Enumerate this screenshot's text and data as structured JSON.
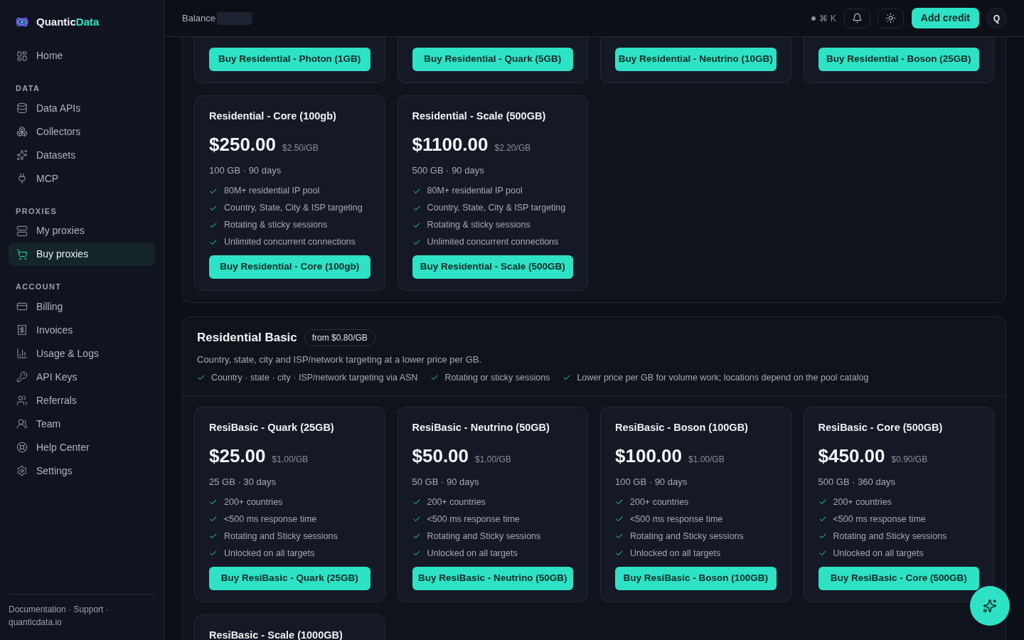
{
  "brand": {
    "name_start": "Quantic",
    "name_end": "Data"
  },
  "nav": [
    {
      "kind": "item",
      "label": "Home",
      "selected": false
    },
    {
      "kind": "heading",
      "label": "DATA"
    },
    {
      "kind": "item",
      "label": "Data APIs",
      "selected": false
    },
    {
      "kind": "item",
      "label": "Collectors",
      "selected": false
    },
    {
      "kind": "item",
      "label": "Datasets",
      "selected": false
    },
    {
      "kind": "item",
      "label": "MCP",
      "selected": false
    },
    {
      "kind": "heading",
      "label": "PROXIES"
    },
    {
      "kind": "item",
      "label": "My proxies",
      "selected": false
    },
    {
      "kind": "item",
      "label": "Buy proxies",
      "selected": true
    },
    {
      "kind": "heading",
      "label": "ACCOUNT"
    },
    {
      "kind": "item",
      "label": "Billing",
      "selected": false
    },
    {
      "kind": "item",
      "label": "Invoices",
      "selected": false
    },
    {
      "kind": "item",
      "label": "Usage & Logs",
      "selected": false
    },
    {
      "kind": "item",
      "label": "API Keys",
      "selected": false
    },
    {
      "kind": "item",
      "label": "Referrals",
      "selected": false
    },
    {
      "kind": "item",
      "label": "Team",
      "selected": false
    },
    {
      "kind": "item",
      "label": "Help Center",
      "selected": false
    },
    {
      "kind": "item",
      "label": "Settings",
      "selected": false
    }
  ],
  "sidebar_footer": "Documentation · Support · quanticdata.io",
  "header": {
    "balance_label": "Balance",
    "shortcut": "⌘ K",
    "add_credit": "Add credit",
    "avatar": "Q"
  },
  "sections": [
    {
      "cards": [
        {
          "kind": "bottom_only",
          "button": "Buy Residential - Photon (1GB)"
        },
        {
          "kind": "bottom_only",
          "button": "Buy Residential - Quark (5GB)"
        },
        {
          "kind": "bottom_only",
          "button": "Buy Residential - Neutrino (10GB)"
        },
        {
          "kind": "bottom_only",
          "button": "Buy Residential - Boson (25GB)"
        },
        {
          "kind": "full",
          "title": "Residential - Core (100gb)",
          "price": "$250.00",
          "per_gb": "$2.50/GB",
          "terms": "100 GB · 90 days",
          "features": [
            "80M+ residential IP pool",
            "Country, State, City & ISP targeting",
            "Rotating & sticky sessions",
            "Unlimited concurrent connections"
          ],
          "button": "Buy Residential - Core (100gb)"
        },
        {
          "kind": "full",
          "title": "Residential - Scale (500GB)",
          "price": "$1100.00",
          "per_gb": "$2.20/GB",
          "terms": "500 GB · 90 days",
          "features": [
            "80M+ residential IP pool",
            "Country, State, City & ISP targeting",
            "Rotating & sticky sessions",
            "Unlimited concurrent connections"
          ],
          "button": "Buy Residential - Scale (500GB)"
        }
      ]
    },
    {
      "title": "Residential Basic",
      "badge": "from $0.80/GB",
      "description": "Country, state, city and ISP/network targeting at a lower price per GB.",
      "features": [
        "Country · state · city · ISP/network targeting via ASN",
        "Rotating or sticky sessions",
        "Lower price per GB for volume work; locations depend on the pool catalog"
      ],
      "cards": [
        {
          "kind": "full",
          "title": "ResiBasic - Quark (25GB)",
          "price": "$25.00",
          "per_gb": "$1.00/GB",
          "terms": "25 GB · 30 days",
          "features": [
            "200+ countries",
            "<500 ms response time",
            "Rotating and Sticky sessions",
            "Unlocked on all targets"
          ],
          "button": "Buy ResiBasic - Quark (25GB)"
        },
        {
          "kind": "full",
          "title": "ResiBasic - Neutrino (50GB)",
          "price": "$50.00",
          "per_gb": "$1.00/GB",
          "terms": "50 GB · 90 days",
          "features": [
            "200+ countries",
            "<500 ms response time",
            "Rotating and Sticky sessions",
            "Unlocked on all targets"
          ],
          "button": "Buy ResiBasic - Neutrino (50GB)"
        },
        {
          "kind": "full",
          "title": "ResiBasic - Boson (100GB)",
          "price": "$100.00",
          "per_gb": "$1.00/GB",
          "terms": "100 GB · 90 days",
          "features": [
            "200+ countries",
            "<500 ms response time",
            "Rotating and Sticky sessions",
            "Unlocked on all targets"
          ],
          "button": "Buy ResiBasic - Boson (100GB)"
        },
        {
          "kind": "full",
          "title": "ResiBasic - Core (500GB)",
          "price": "$450.00",
          "per_gb": "$0.90/GB",
          "terms": "500 GB · 360 days",
          "features": [
            "200+ countries",
            "<500 ms response time",
            "Rotating and Sticky sessions",
            "Unlocked on all targets"
          ],
          "button": "Buy ResiBasic - Core (500GB)"
        },
        {
          "kind": "top_only",
          "title": "ResiBasic - Scale (1000GB)"
        }
      ]
    }
  ]
}
